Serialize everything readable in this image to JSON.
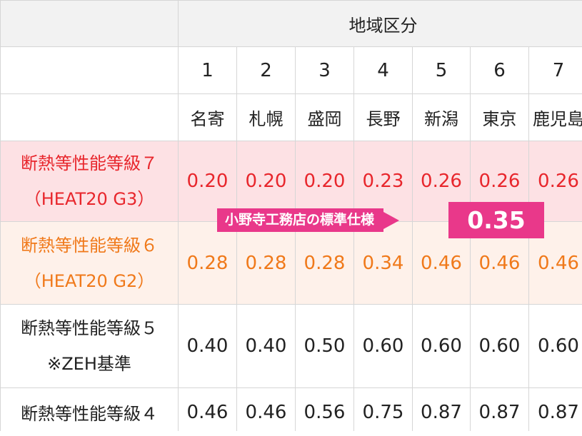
{
  "table": {
    "region_header": "地域区分",
    "zones": [
      "1",
      "2",
      "3",
      "4",
      "5",
      "6",
      "7"
    ],
    "cities": [
      "名寄",
      "札幌",
      "盛岡",
      "長野",
      "新潟",
      "東京",
      "鹿児島"
    ],
    "rows": [
      {
        "label_line1": "断熱等性能等級７",
        "label_line2": "（HEAT20 G3）",
        "values": [
          "0.20",
          "0.20",
          "0.20",
          "0.23",
          "0.26",
          "0.26",
          "0.26"
        ]
      },
      {
        "label_line1": "断熱等性能等級６",
        "label_line2": "（HEAT20 G2）",
        "values": [
          "0.28",
          "0.28",
          "0.28",
          "0.34",
          "0.46",
          "0.46",
          "0.46"
        ]
      },
      {
        "label_line1": "断熱等性能等級５",
        "label_line2": "※ZEH基準",
        "values": [
          "0.40",
          "0.40",
          "0.50",
          "0.60",
          "0.60",
          "0.60",
          "0.60"
        ]
      },
      {
        "label_line1": "断熱等性能等級４",
        "values": [
          "0.46",
          "0.46",
          "0.56",
          "0.75",
          "0.87",
          "0.87",
          "0.87"
        ]
      }
    ]
  },
  "callout": {
    "label": "小野寺工務店の標準仕様",
    "value": "0.35"
  },
  "colors": {
    "g3_text": "#e8262c",
    "g3_bg": "#fde1e4",
    "g2_text": "#f0791a",
    "g2_bg": "#fef1ea",
    "callout_bg": "#e9388a"
  }
}
